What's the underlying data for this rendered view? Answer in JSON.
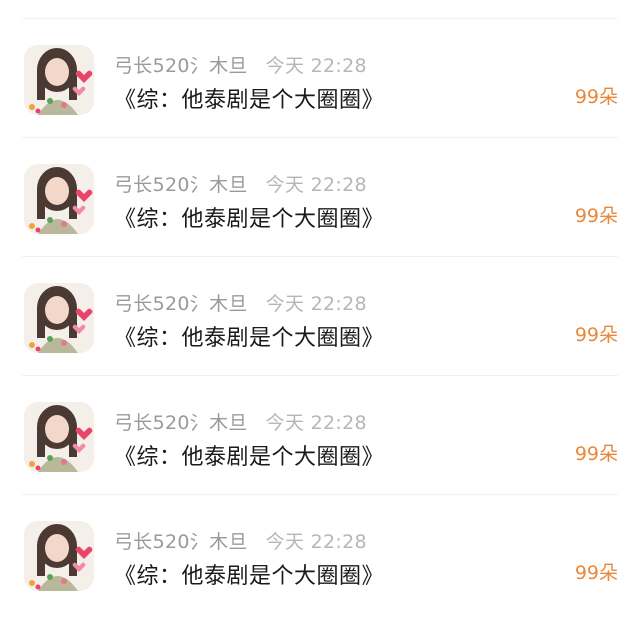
{
  "colors": {
    "username": "#9a9a9a",
    "time": "#b6b6b6",
    "title": "#1a1a1a",
    "flowers": "#e9883a"
  },
  "rows": [
    {
      "username": "弓长520氵木旦",
      "time": "今天 22:28",
      "title": "《综：他泰剧是个大圈圈》",
      "flowers": "99朵"
    },
    {
      "username": "弓长520氵木旦",
      "time": "今天 22:28",
      "title": "《综：他泰剧是个大圈圈》",
      "flowers": "99朵"
    },
    {
      "username": "弓长520氵木旦",
      "time": "今天 22:28",
      "title": "《综：他泰剧是个大圈圈》",
      "flowers": "99朵"
    },
    {
      "username": "弓长520氵木旦",
      "time": "今天 22:28",
      "title": "《综：他泰剧是个大圈圈》",
      "flowers": "99朵"
    },
    {
      "username": "弓长520氵木旦",
      "time": "今天 22:28",
      "title": "《综：他泰剧是个大圈圈》",
      "flowers": "99朵"
    }
  ]
}
